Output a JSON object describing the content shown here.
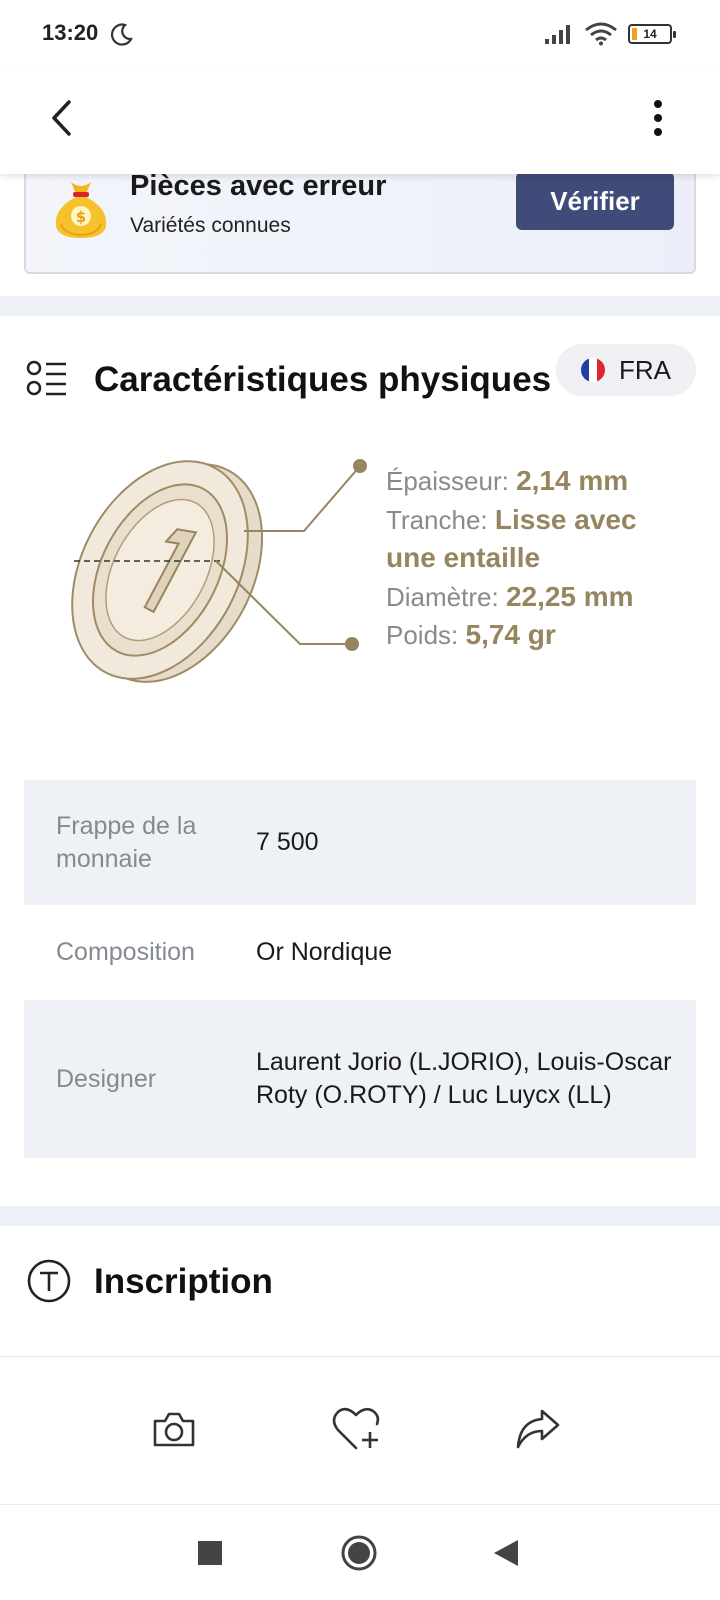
{
  "status_bar": {
    "time": "13:20",
    "battery_level": "14",
    "battery_fraction": 0.14
  },
  "nav": {
    "back_icon": "chevron-left-icon",
    "more_icon": "more-vert-icon"
  },
  "error_banner": {
    "title": "Pièces avec erreur",
    "subtitle": "Variétés connues",
    "button_label": "Vérifier",
    "button_color": "#3f4b78",
    "icon": "money-bag-icon"
  },
  "physical": {
    "title": "Caractéristiques physiques",
    "language_code": "FRA",
    "icon": "list-icon",
    "specs": {
      "thickness_label": "Épaisseur:",
      "thickness_value": "2,14 mm",
      "edge_label": "Tranche:",
      "edge_value": "Lisse avec une entaille",
      "diameter_label": "Diamètre:",
      "diameter_value": "22,25 mm",
      "weight_label": "Poids:",
      "weight_value": "5,74 gr"
    },
    "accent_color": "#96855e"
  },
  "details": [
    {
      "label": "Frappe de la monnaie",
      "value": "7 500"
    },
    {
      "label": "Composition",
      "value": "Or Nordique"
    },
    {
      "label": "Designer",
      "value": "Laurent Jorio (L.JORIO), Louis-Oscar Roty (O.ROTY) / Luc Luycx (LL)"
    }
  ],
  "inscription": {
    "title": "Inscription",
    "icon": "text-circle-icon"
  },
  "actions": [
    {
      "icon": "camera-icon"
    },
    {
      "icon": "heart-plus-icon"
    },
    {
      "icon": "share-icon"
    }
  ],
  "system_nav": [
    {
      "icon": "recents-square-icon"
    },
    {
      "icon": "home-circle-icon"
    },
    {
      "icon": "back-triangle-icon"
    }
  ]
}
